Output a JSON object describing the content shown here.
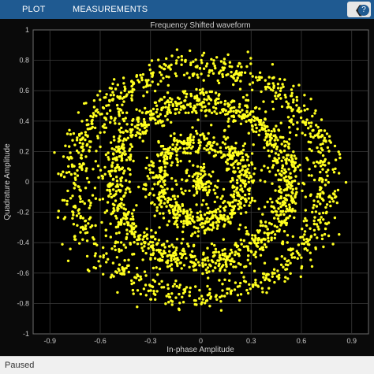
{
  "toolstrip": {
    "tabs": [
      "PLOT",
      "MEASUREMENTS"
    ],
    "collapse_glyph": "❮",
    "help_glyph": "?"
  },
  "status": {
    "text": "Paused"
  },
  "colors": {
    "toolstrip": "#1f5a91",
    "background": "#0a0a0a",
    "points": "#ffff1e",
    "grid": "#3a3a3a",
    "axis_text": "#c8c8c8"
  },
  "chart_data": {
    "type": "scatter",
    "title": "Frequency Shifted waveform",
    "xlabel": "In-phase Amplitude",
    "ylabel": "Quadrature Amplitude",
    "xlim": [
      -1,
      1
    ],
    "ylim": [
      -1,
      1
    ],
    "xticks": [
      "-0.9",
      "-0.6",
      "-0.3",
      "0",
      "0.3",
      "0.6",
      "0.9"
    ],
    "yticks": [
      "1",
      "0.8",
      "0.6",
      "0.4",
      "0.2",
      "0",
      "-0.2",
      "-0.4",
      "-0.6",
      "-0.8",
      "-1"
    ],
    "grid": true,
    "series": [
      {
        "marker_color": "#ffff1e",
        "rings": [
          {
            "radius": 0.06,
            "spread": 0.035,
            "count": 90
          },
          {
            "radius": 0.26,
            "spread": 0.045,
            "count": 650
          },
          {
            "radius": 0.52,
            "spread": 0.045,
            "count": 1150
          },
          {
            "radius": 0.75,
            "spread": 0.055,
            "count": 1000
          }
        ]
      }
    ]
  }
}
